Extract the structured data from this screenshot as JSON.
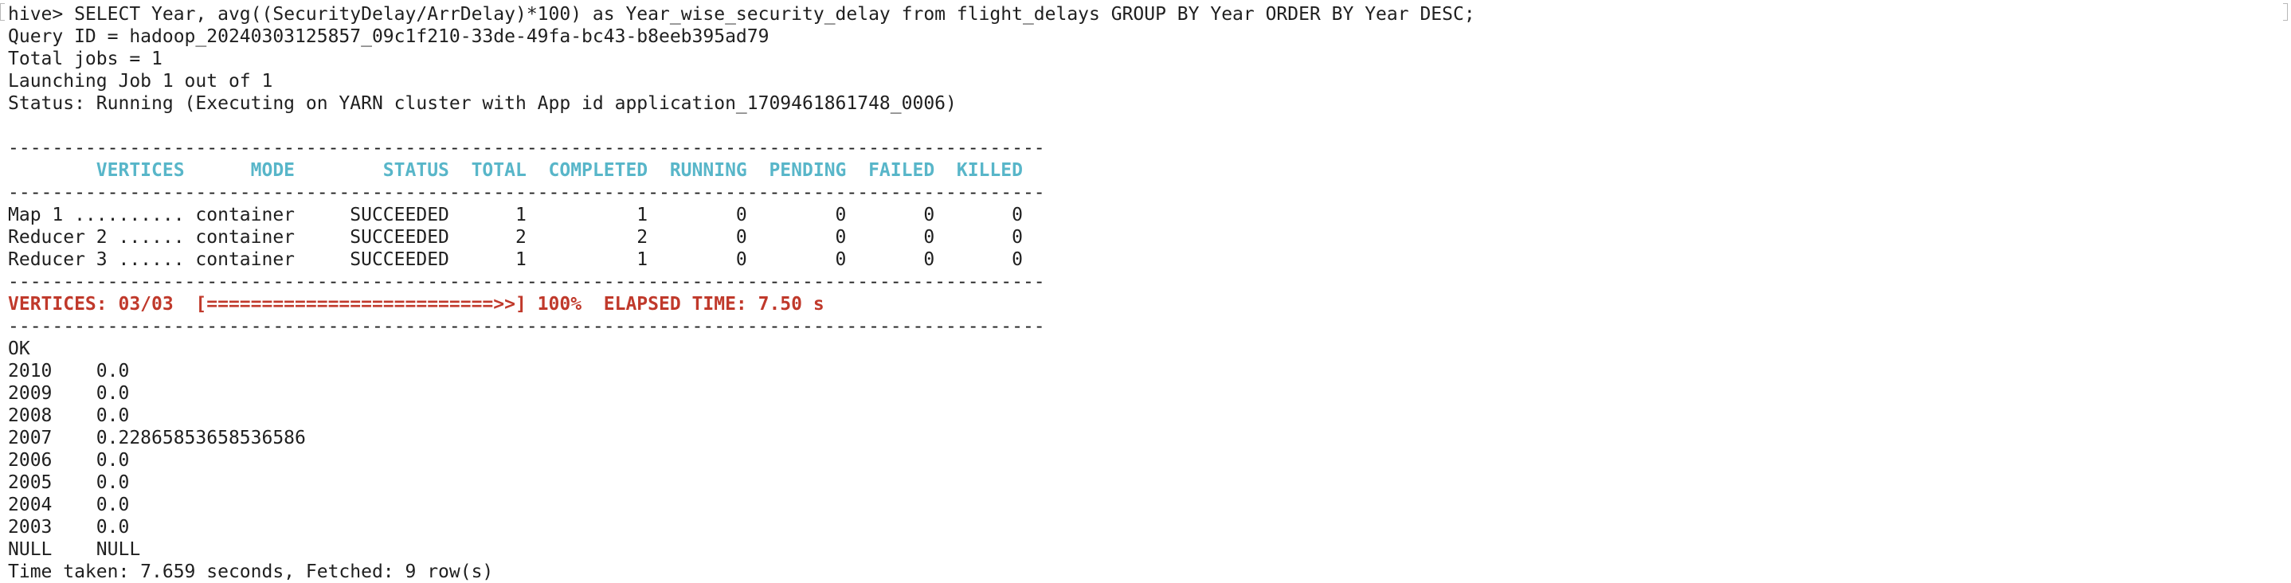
{
  "terminal": {
    "command": {
      "prompt": "hive> ",
      "query": "SELECT Year, avg((SecurityDelay/ArrDelay)*100) as Year_wise_security_delay from flight_delays GROUP BY Year ORDER BY Year DESC;"
    },
    "info_lines": [
      "Query ID = hadoop_20240303125857_09c1f210-33de-49fa-bc43-b8eeb395ad79",
      "Total jobs = 1",
      "Launching Job 1 out of 1",
      "Status: Running (Executing on YARN cluster with App id application_1709461861748_0006)"
    ],
    "separator": "----------------------------------------------------------------------------------------------",
    "progress_table": {
      "header": "        VERTICES      MODE        STATUS  TOTAL  COMPLETED  RUNNING  PENDING  FAILED  KILLED",
      "rows": [
        "Map 1 .......... container     SUCCEEDED      1          1        0        0       0       0",
        "Reducer 2 ...... container     SUCCEEDED      2          2        0        0       0       0",
        "Reducer 3 ...... container     SUCCEEDED      1          1        0        0       0       0"
      ],
      "progress_line": "VERTICES: 03/03  [==========================>>] 100%  ELAPSED TIME: 7.50 s"
    },
    "result_status": "OK",
    "results": [
      "2010    0.0",
      "2009    0.0",
      "2008    0.0",
      "2007    0.22865853658536586",
      "2006    0.0",
      "2005    0.0",
      "2004    0.0",
      "2003    0.0",
      "NULL    NULL"
    ],
    "summary": "Time taken: 7.659 seconds, Fetched: 9 row(s)"
  }
}
